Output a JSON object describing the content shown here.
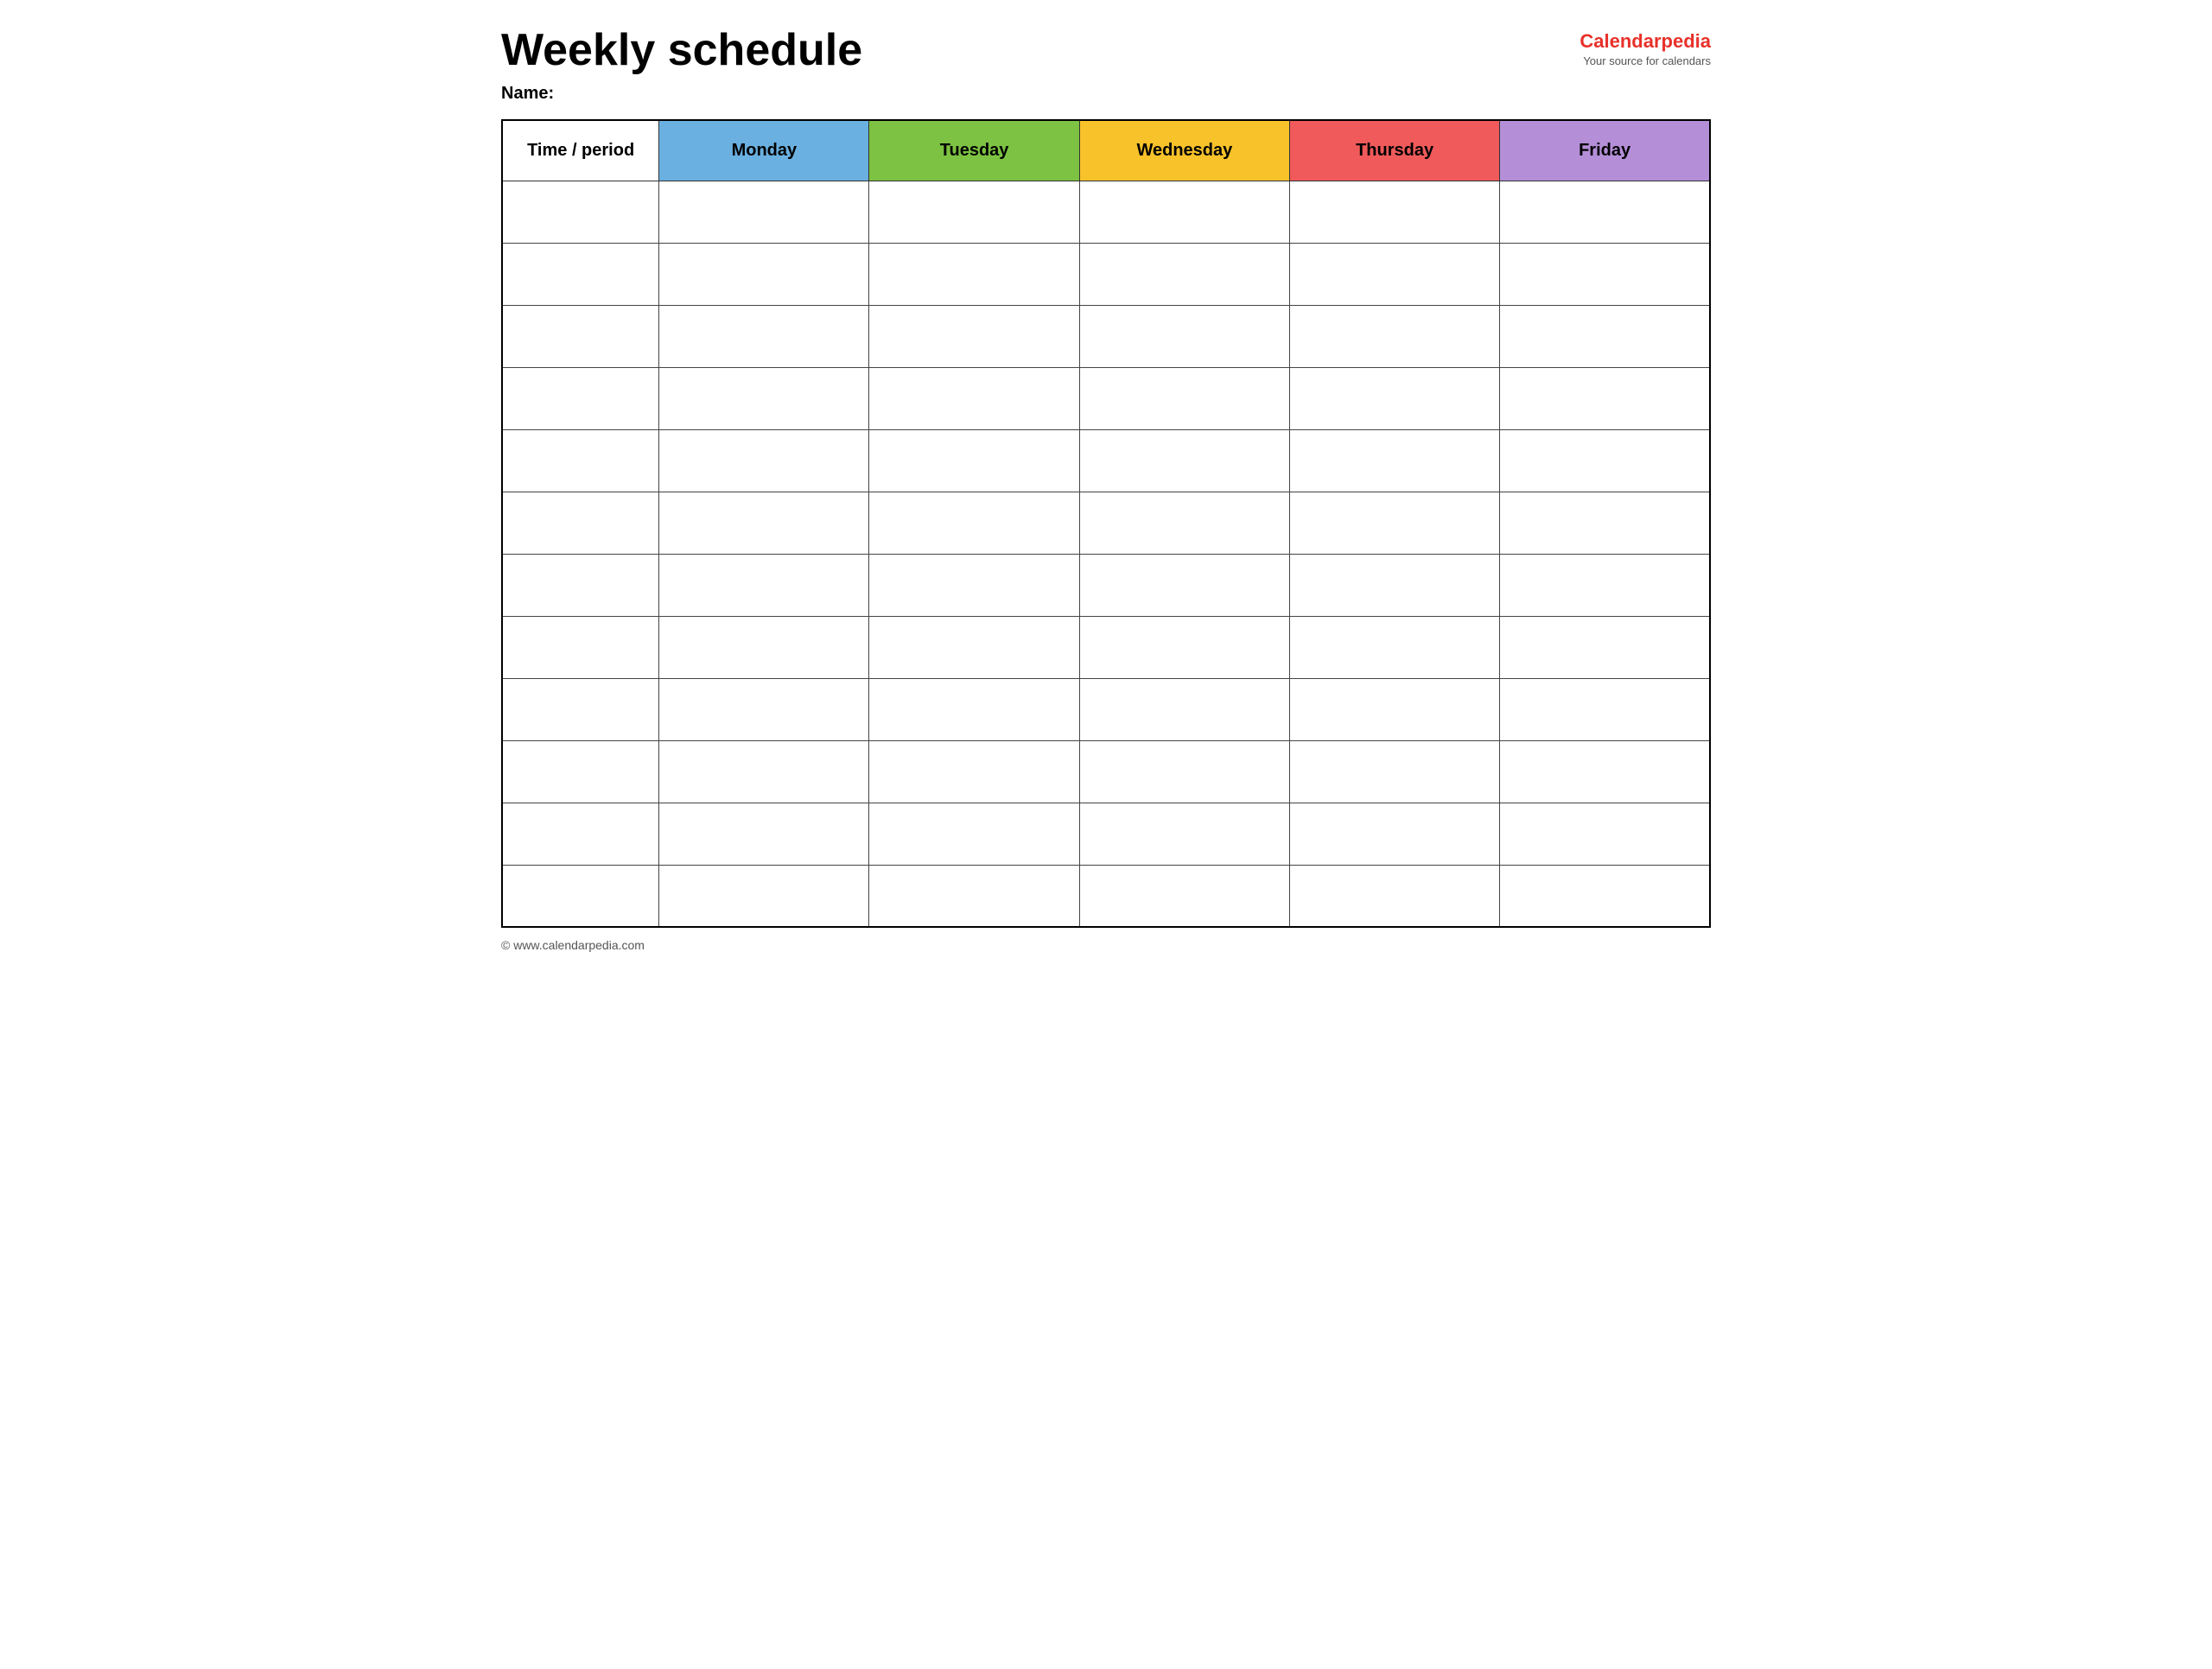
{
  "page": {
    "title": "Weekly schedule",
    "name_label": "Name:"
  },
  "logo": {
    "text_black": "Calendar",
    "text_red": "pedia",
    "tagline": "Your source for calendars"
  },
  "table": {
    "headers": [
      {
        "id": "time",
        "label": "Time / period",
        "color_class": "col-time"
      },
      {
        "id": "monday",
        "label": "Monday",
        "color_class": "col-monday"
      },
      {
        "id": "tuesday",
        "label": "Tuesday",
        "color_class": "col-tuesday"
      },
      {
        "id": "wednesday",
        "label": "Wednesday",
        "color_class": "col-wednesday"
      },
      {
        "id": "thursday",
        "label": "Thursday",
        "color_class": "col-thursday"
      },
      {
        "id": "friday",
        "label": "Friday",
        "color_class": "col-friday"
      }
    ],
    "row_count": 12
  },
  "footer": {
    "url": "© www.calendarpedia.com"
  }
}
